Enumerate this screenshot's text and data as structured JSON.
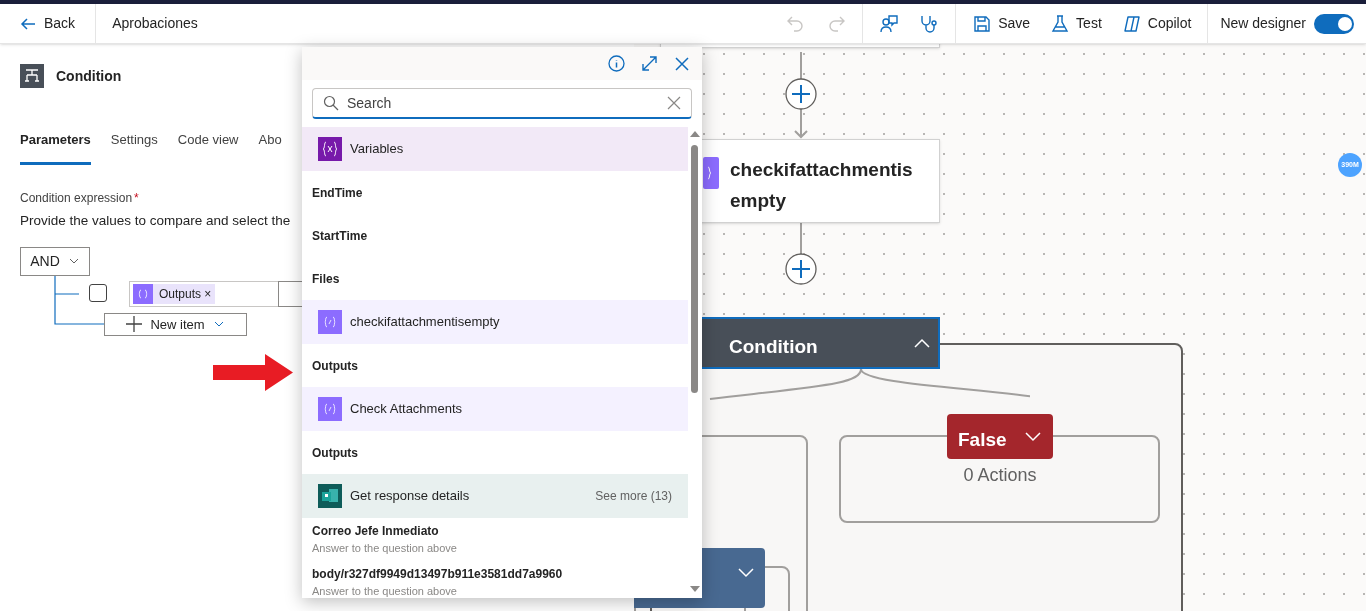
{
  "header": {
    "back": "Back",
    "title": "Aprobaciones"
  },
  "toolbar": [
    {
      "kind": "undo",
      "disabled": true
    },
    {
      "kind": "redo",
      "disabled": true
    },
    {
      "kind": "feedback",
      "disabled": false
    },
    {
      "kind": "checker",
      "disabled": false
    },
    {
      "kind": "save",
      "label": "Save",
      "disabled": false
    },
    {
      "kind": "test",
      "label": "Test",
      "disabled": false
    },
    {
      "kind": "copilot",
      "label": "Copilot",
      "disabled": false
    }
  ],
  "new_designer": {
    "label": "New designer",
    "on": true
  },
  "panel": {
    "title": "Condition",
    "tabs": [
      {
        "label": "Parameters",
        "selected": true
      },
      {
        "label": "Settings",
        "selected": false
      },
      {
        "label": "Code view",
        "selected": false
      },
      {
        "label": "Abo",
        "selected": false
      }
    ],
    "field_label": "Condition expression",
    "required_mark": "*",
    "hint": "Provide the values to compare and select the",
    "operator": "AND",
    "rows": [
      {
        "checked": false,
        "token": "Outputs",
        "remove": "×"
      }
    ],
    "add_button": "New item"
  },
  "popup": {
    "search_placeholder": "Search",
    "items": [
      {
        "kind": "variables",
        "title": "Variables",
        "color": "#7719aa"
      },
      {
        "kind": "item",
        "title": "EndTime"
      },
      {
        "kind": "item",
        "title": "StartTime"
      },
      {
        "kind": "item",
        "title": "Files"
      },
      {
        "kind": "action",
        "title": "checkifattachmentisempty",
        "color": "#8c6cff"
      },
      {
        "kind": "item",
        "title": "Outputs"
      },
      {
        "kind": "action",
        "title": "Check Attachments",
        "color": "#8c6cff"
      },
      {
        "kind": "item",
        "title": "Outputs"
      },
      {
        "kind": "forms",
        "title": "Get response details",
        "color": "#0e5c59",
        "see_more": "See more (13)"
      },
      {
        "kind": "item",
        "title": "Correo Jefe Inmediato",
        "subtitle": "Answer to the question above"
      },
      {
        "kind": "item",
        "title": "body/r327df9949d13497b911e3581dd7a9960",
        "subtitle": "Answer to the question above"
      }
    ]
  },
  "canvas": {
    "compose_node": "checkifattachmentisempty",
    "condition": {
      "title": "Condition",
      "expanded": true
    },
    "false_branch": {
      "label": "False",
      "actions": "0 Actions"
    },
    "memory_badge": "390M"
  }
}
